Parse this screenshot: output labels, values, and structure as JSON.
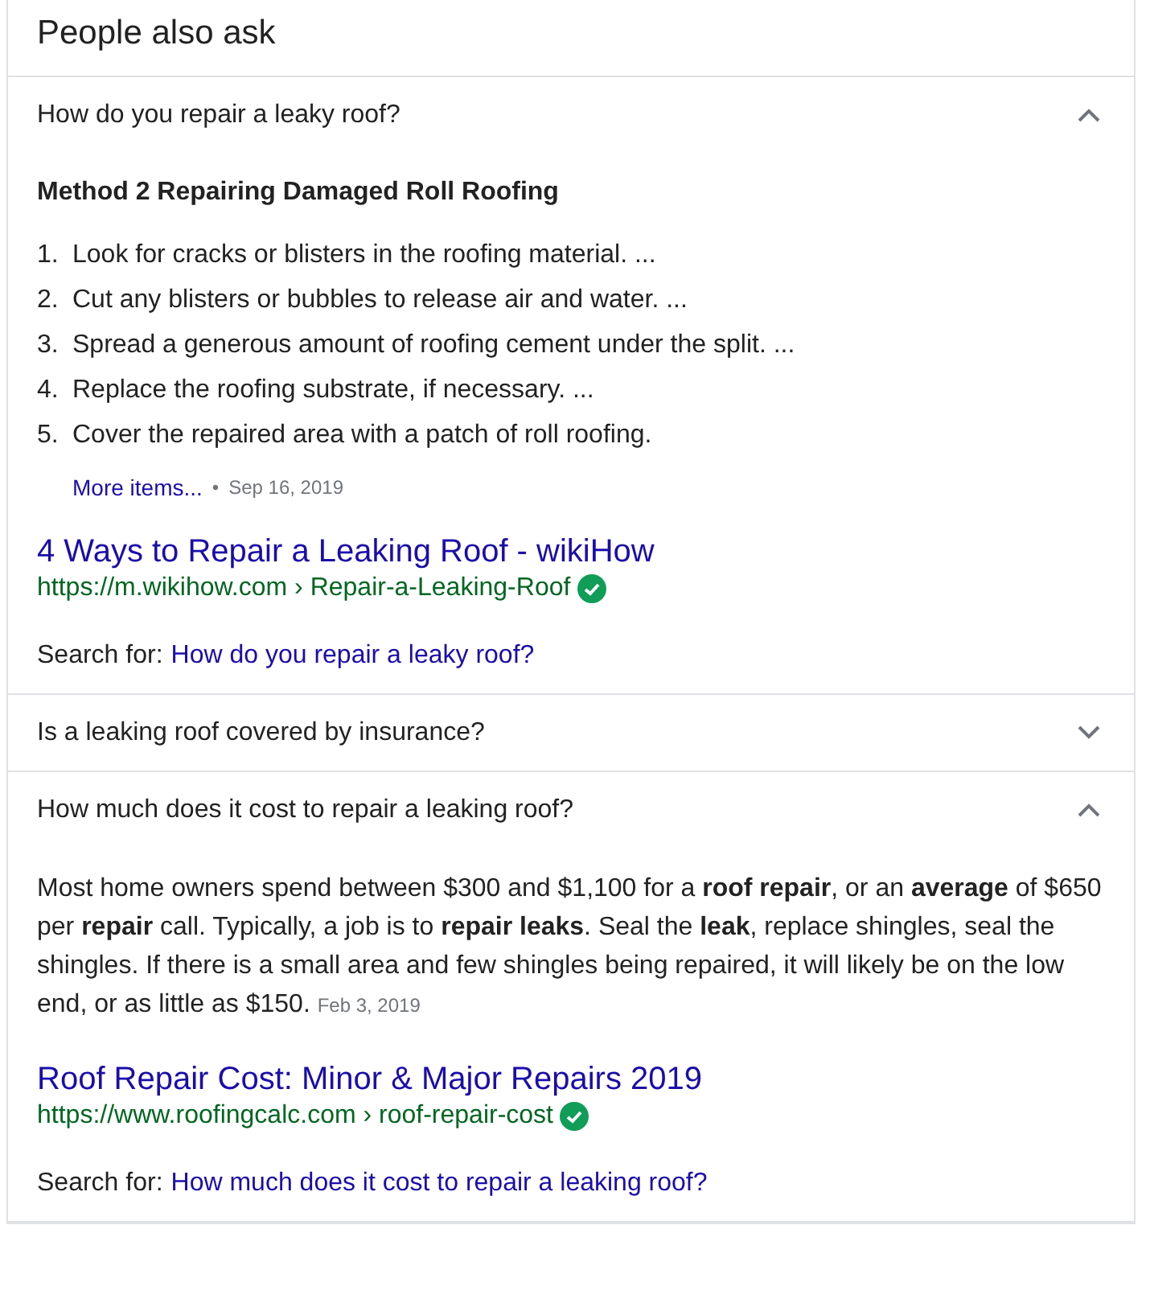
{
  "title": "People also ask",
  "questions": [
    {
      "question": "How do you repair a leaky roof?",
      "expanded": true,
      "kind": "list",
      "heading": "Method 2 Repairing Damaged Roll Roofing",
      "items": [
        {
          "number": "1.",
          "text": "Look for cracks or blisters in the roofing material. ..."
        },
        {
          "number": "2.",
          "text": "Cut any blisters or bubbles to release air and water. ..."
        },
        {
          "number": "3.",
          "text": "Spread a generous amount of roofing cement under the split. ..."
        },
        {
          "number": "4.",
          "text": "Replace the roofing substrate, if necessary. ..."
        },
        {
          "number": "5.",
          "text": "Cover the repaired area with a patch of roll roofing."
        }
      ],
      "more": "More items...",
      "separator": "•",
      "date": "Sep 16, 2019",
      "result_title": "4 Ways to Repair a Leaking Roof - wikiHow",
      "url": "https://m.wikihow.com › Repair-a-Leaking-Roof",
      "search_label": "Search for:",
      "search_link": "How do you repair a leaky roof?"
    },
    {
      "question": "Is a leaking roof covered by insurance?",
      "expanded": false
    },
    {
      "question": "How much does it cost to repair a leaking roof?",
      "expanded": true,
      "kind": "paragraph",
      "text": "Most home owners spend between $300 and $1,100 for a **roof repair**, or an **average** of $650 per **repair** call. Typically, a job is to **repair leaks**. Seal the **leak**, replace shingles, seal the shingles. If there is a small area and few shingles being repaired, it will likely be on the low end, or as little as $150.",
      "date": "Feb 3, 2019",
      "result_title": "Roof Repair Cost: Minor & Major Repairs 2019",
      "url": "https://www.roofingcalc.com › roof-repair-cost",
      "search_label": "Search for:",
      "search_link": "How much does it cost to repair a leaking roof?"
    }
  ]
}
